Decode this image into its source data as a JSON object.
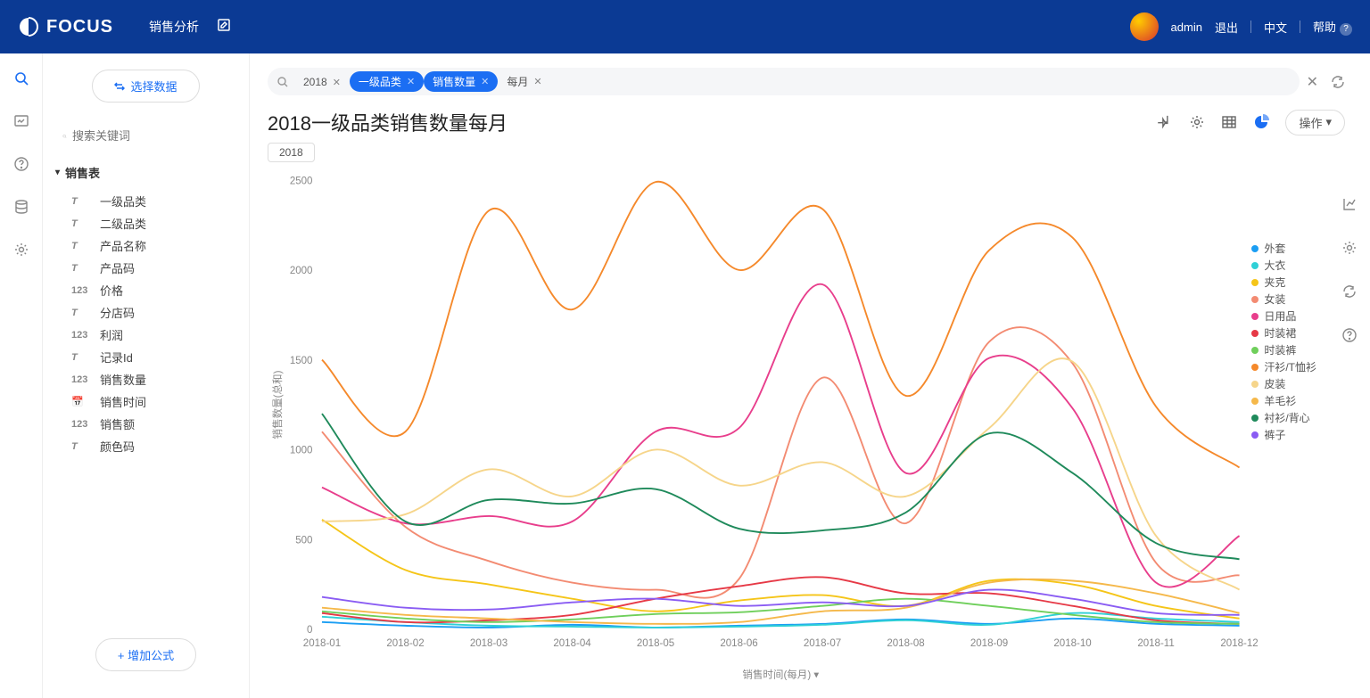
{
  "brand": "FOCUS",
  "nav_title": "销售分析",
  "user": {
    "name": "admin",
    "logout": "退出",
    "lang": "中文",
    "help": "帮助"
  },
  "sidebar": {
    "select_data": "选择数据",
    "search_placeholder": "搜索关键词",
    "table_name": "销售表",
    "fields": [
      {
        "type": "T",
        "label": "一级品类"
      },
      {
        "type": "T",
        "label": "二级品类"
      },
      {
        "type": "T",
        "label": "产品名称"
      },
      {
        "type": "T",
        "label": "产品码"
      },
      {
        "type": "123",
        "label": "价格"
      },
      {
        "type": "T",
        "label": "分店码"
      },
      {
        "type": "123",
        "label": "利润"
      },
      {
        "type": "T",
        "label": "记录Id"
      },
      {
        "type": "123",
        "label": "销售数量"
      },
      {
        "type": "📅",
        "label": "销售时间"
      },
      {
        "type": "123",
        "label": "销售额"
      },
      {
        "type": "T",
        "label": "颜色码"
      }
    ],
    "add_formula": "+ 增加公式"
  },
  "query": {
    "pills": [
      {
        "text": "2018",
        "style": "plain"
      },
      {
        "text": "一级品类",
        "style": "blue"
      },
      {
        "text": "销售数量",
        "style": "blue"
      },
      {
        "text": "每月",
        "style": "plain"
      }
    ]
  },
  "title": "2018一级品类销售数量每月",
  "ops_label": "操作",
  "year_chip": "2018",
  "chart_data": {
    "type": "line",
    "title": "2018一级品类销售数量每月",
    "xlabel": "销售时间(每月)",
    "ylabel": "销售数量(总和)",
    "ylim": [
      0,
      2500
    ],
    "categories": [
      "2018-01",
      "2018-02",
      "2018-03",
      "2018-04",
      "2018-05",
      "2018-06",
      "2018-07",
      "2018-08",
      "2018-09",
      "2018-10",
      "2018-11",
      "2018-12"
    ],
    "series": [
      {
        "name": "外套",
        "color": "#1b9ef3",
        "values": [
          40,
          20,
          10,
          25,
          10,
          20,
          30,
          55,
          30,
          60,
          30,
          20
        ]
      },
      {
        "name": "大衣",
        "color": "#2fd0d6",
        "values": [
          70,
          40,
          20,
          15,
          10,
          15,
          25,
          50,
          25,
          90,
          60,
          40
        ]
      },
      {
        "name": "夹克",
        "color": "#f5c518",
        "values": [
          610,
          330,
          250,
          170,
          100,
          160,
          190,
          130,
          270,
          250,
          130,
          60
        ]
      },
      {
        "name": "女装",
        "color": "#f38b72",
        "values": [
          1100,
          570,
          380,
          260,
          220,
          280,
          1400,
          590,
          1600,
          1480,
          370,
          300
        ]
      },
      {
        "name": "日用品",
        "color": "#e83e8c",
        "values": [
          790,
          590,
          630,
          600,
          1100,
          1120,
          1920,
          870,
          1510,
          1230,
          260,
          520
        ]
      },
      {
        "name": "时装裙",
        "color": "#e63946",
        "values": [
          90,
          40,
          50,
          80,
          170,
          240,
          290,
          200,
          200,
          130,
          50,
          30
        ]
      },
      {
        "name": "时装裤",
        "color": "#6fcf5b",
        "values": [
          100,
          60,
          40,
          55,
          85,
          95,
          130,
          170,
          130,
          80,
          40,
          30
        ]
      },
      {
        "name": "汗衫/T恤衫",
        "color": "#f5892b",
        "values": [
          1500,
          1100,
          2330,
          1780,
          2490,
          2000,
          2340,
          1300,
          2110,
          2180,
          1240,
          900
        ]
      },
      {
        "name": "皮装",
        "color": "#f6d58a",
        "values": [
          600,
          640,
          890,
          740,
          1000,
          800,
          930,
          740,
          1120,
          1490,
          520,
          220
        ]
      },
      {
        "name": "羊毛衫",
        "color": "#f5b84a",
        "values": [
          120,
          80,
          60,
          40,
          30,
          40,
          100,
          120,
          260,
          270,
          200,
          90
        ]
      },
      {
        "name": "衬衫/背心",
        "color": "#1f8a5b",
        "values": [
          1200,
          600,
          720,
          700,
          780,
          560,
          550,
          650,
          1090,
          870,
          480,
          390
        ]
      },
      {
        "name": "裤子",
        "color": "#8a5cf3",
        "values": [
          180,
          120,
          110,
          150,
          170,
          130,
          150,
          130,
          220,
          170,
          90,
          80
        ]
      }
    ]
  }
}
